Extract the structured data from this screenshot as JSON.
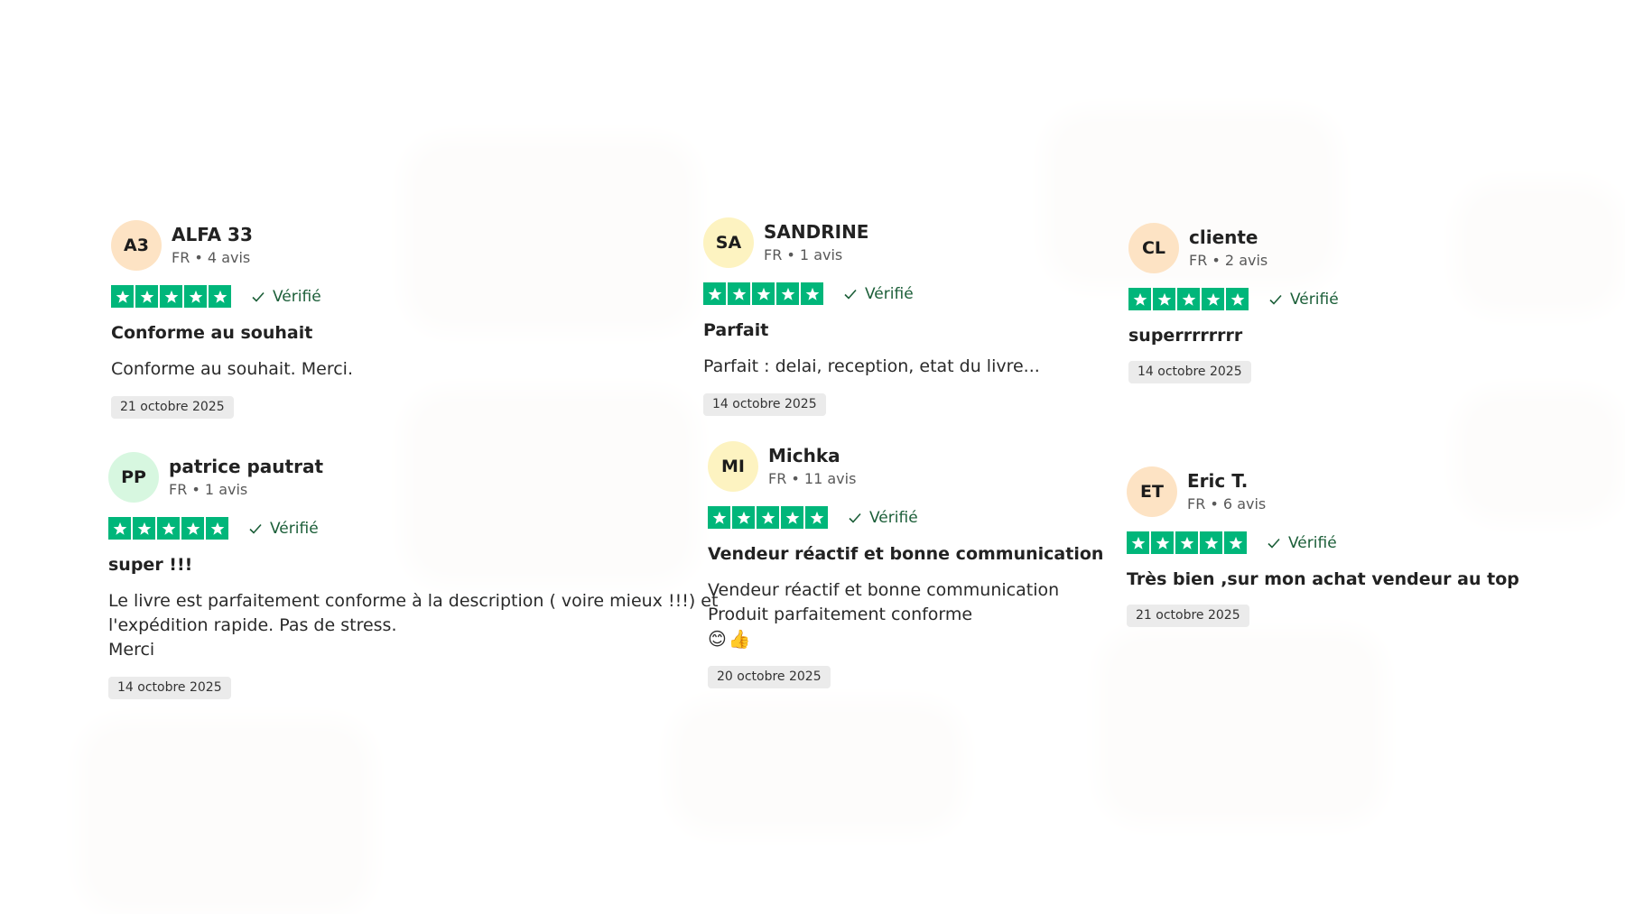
{
  "brand": {
    "star_color": "#00b67a",
    "verified_color": "#1b5e38",
    "date_chip_color": "#ebebeb"
  },
  "reviews": [
    {
      "initials": "A3",
      "name": "ALFA 33",
      "meta": "FR • 4 avis",
      "rating": 5,
      "verified": "Vérifié",
      "title": "Conforme au souhait",
      "body": [
        "Conforme au souhait. Merci."
      ],
      "date": "21 octobre 2025"
    },
    {
      "initials": "PP",
      "name": "patrice pautrat",
      "meta": "FR • 1 avis",
      "rating": 5,
      "verified": "Vérifié",
      "title": "super !!!",
      "body": [
        "Le livre est parfaitement conforme à la description ( voire mieux !!!) et",
        "l'expédition rapide. Pas de stress.",
        "Merci"
      ],
      "date": "14 octobre 2025"
    },
    {
      "initials": "SA",
      "name": "SANDRINE",
      "meta": "FR • 1 avis",
      "rating": 5,
      "verified": "Vérifié",
      "title": "Parfait",
      "body": [
        "Parfait : delai, reception, etat du livre..."
      ],
      "date": "14 octobre 2025"
    },
    {
      "initials": "MI",
      "name": "Michka",
      "meta": "FR • 11 avis",
      "rating": 5,
      "verified": "Vérifié",
      "title": "Vendeur réactif et bonne communication",
      "body": [
        "Vendeur réactif et bonne communication",
        "Produit parfaitement conforme"
      ],
      "emoji": "😊👍",
      "date": "20 octobre 2025"
    },
    {
      "initials": "CL",
      "name": "cliente",
      "meta": "FR • 2 avis",
      "rating": 5,
      "verified": "Vérifié",
      "title": "superrrrrrrr",
      "body": [],
      "date": "14 octobre 2025"
    },
    {
      "initials": "ET",
      "name": "Eric T.",
      "meta": "FR • 6 avis",
      "rating": 5,
      "verified": "Vérifié",
      "title": "Très bien ,sur mon achat vendeur au top",
      "body": [],
      "date": "21 octobre 2025"
    }
  ]
}
